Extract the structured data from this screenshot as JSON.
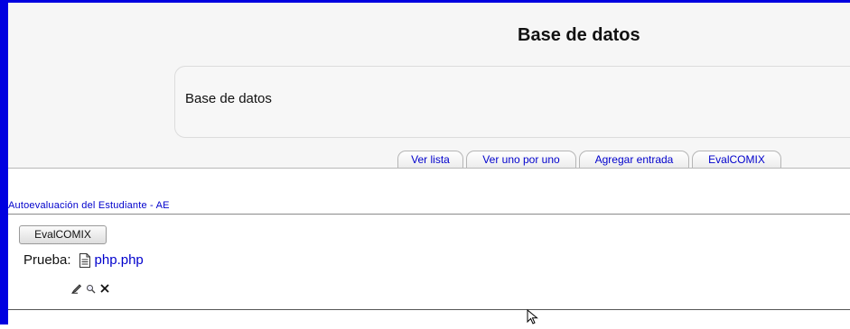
{
  "header": {
    "title": "Base de datos",
    "intro": "Base de datos"
  },
  "tabs": [
    {
      "label": "Ver lista"
    },
    {
      "label": "Ver uno por uno"
    },
    {
      "label": "Agregar entrada"
    },
    {
      "label": "EvalCOMIX"
    }
  ],
  "section": {
    "link": "Autoevaluación del Estudiante - AE"
  },
  "entry": {
    "button_label": "EvalCOMIX",
    "field_label": "Prueba:",
    "file_name": "php.php",
    "actions": [
      {
        "icon": "edit-icon"
      },
      {
        "icon": "search-icon"
      },
      {
        "icon": "delete-icon"
      }
    ]
  },
  "colors": {
    "frame_border": "#0000e0",
    "link": "#0000cc",
    "band": "#f6f6f6"
  }
}
